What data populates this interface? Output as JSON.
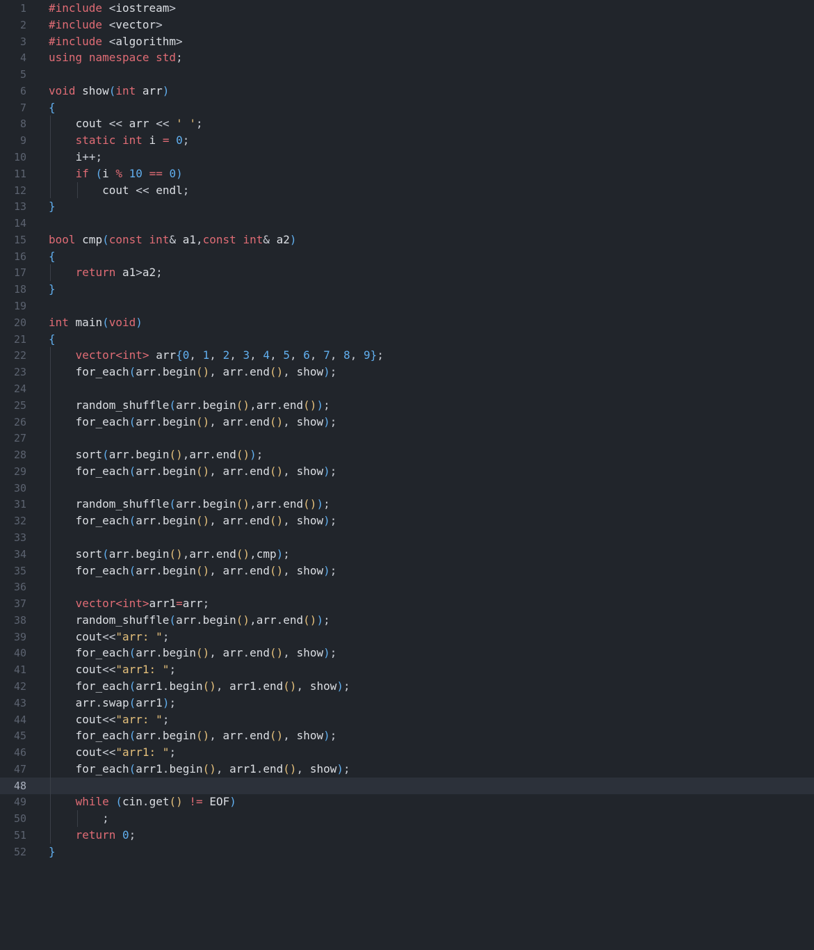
{
  "editor": {
    "active_line": 48,
    "lines": [
      {
        "n": "1",
        "text": "#include <iostream>"
      },
      {
        "n": "2",
        "text": "#include <vector>"
      },
      {
        "n": "3",
        "text": "#include <algorithm>"
      },
      {
        "n": "4",
        "text": "using namespace std;"
      },
      {
        "n": "5",
        "text": ""
      },
      {
        "n": "6",
        "text": "void show(int arr)"
      },
      {
        "n": "7",
        "text": "{"
      },
      {
        "n": "8",
        "text": "    cout << arr << ' ';"
      },
      {
        "n": "9",
        "text": "    static int i = 0;"
      },
      {
        "n": "10",
        "text": "    i++;"
      },
      {
        "n": "11",
        "text": "    if (i % 10 == 0)"
      },
      {
        "n": "12",
        "text": "        cout << endl;"
      },
      {
        "n": "13",
        "text": "}"
      },
      {
        "n": "14",
        "text": ""
      },
      {
        "n": "15",
        "text": "bool cmp(const int& a1,const int& a2)"
      },
      {
        "n": "16",
        "text": "{"
      },
      {
        "n": "17",
        "text": "    return a1>a2;"
      },
      {
        "n": "18",
        "text": "}"
      },
      {
        "n": "19",
        "text": ""
      },
      {
        "n": "20",
        "text": "int main(void)"
      },
      {
        "n": "21",
        "text": "{"
      },
      {
        "n": "22",
        "text": "    vector<int> arr{0, 1, 2, 3, 4, 5, 6, 7, 8, 9};"
      },
      {
        "n": "23",
        "text": "    for_each(arr.begin(), arr.end(), show);"
      },
      {
        "n": "24",
        "text": ""
      },
      {
        "n": "25",
        "text": "    random_shuffle(arr.begin(),arr.end());"
      },
      {
        "n": "26",
        "text": "    for_each(arr.begin(), arr.end(), show);"
      },
      {
        "n": "27",
        "text": ""
      },
      {
        "n": "28",
        "text": "    sort(arr.begin(),arr.end());"
      },
      {
        "n": "29",
        "text": "    for_each(arr.begin(), arr.end(), show);"
      },
      {
        "n": "30",
        "text": ""
      },
      {
        "n": "31",
        "text": "    random_shuffle(arr.begin(),arr.end());"
      },
      {
        "n": "32",
        "text": "    for_each(arr.begin(), arr.end(), show);"
      },
      {
        "n": "33",
        "text": ""
      },
      {
        "n": "34",
        "text": "    sort(arr.begin(),arr.end(),cmp);"
      },
      {
        "n": "35",
        "text": "    for_each(arr.begin(), arr.end(), show);"
      },
      {
        "n": "36",
        "text": ""
      },
      {
        "n": "37",
        "text": "    vector<int>arr1=arr;"
      },
      {
        "n": "38",
        "text": "    random_shuffle(arr.begin(),arr.end());"
      },
      {
        "n": "39",
        "text": "    cout<<\"arr: \";"
      },
      {
        "n": "40",
        "text": "    for_each(arr.begin(), arr.end(), show);"
      },
      {
        "n": "41",
        "text": "    cout<<\"arr1: \";"
      },
      {
        "n": "42",
        "text": "    for_each(arr1.begin(), arr1.end(), show);"
      },
      {
        "n": "43",
        "text": "    arr.swap(arr1);"
      },
      {
        "n": "44",
        "text": "    cout<<\"arr: \";"
      },
      {
        "n": "45",
        "text": "    for_each(arr.begin(), arr.end(), show);"
      },
      {
        "n": "46",
        "text": "    cout<<\"arr1: \";"
      },
      {
        "n": "47",
        "text": "    for_each(arr1.begin(), arr1.end(), show);"
      },
      {
        "n": "48",
        "text": ""
      },
      {
        "n": "49",
        "text": "    while (cin.get() != EOF)"
      },
      {
        "n": "50",
        "text": "        ;"
      },
      {
        "n": "51",
        "text": "    return 0;"
      },
      {
        "n": "52",
        "text": "}"
      }
    ]
  },
  "colors": {
    "background": "#21252b",
    "keyword": "#e06c75",
    "number": "#61afef",
    "string": "#e5c07b",
    "bracket_1": "#61afef",
    "bracket_2": "#e5c07b",
    "bracket_3": "#98c379",
    "text": "#dcdfe4",
    "line_number": "#5c6370",
    "active_line": "#2c313a"
  }
}
